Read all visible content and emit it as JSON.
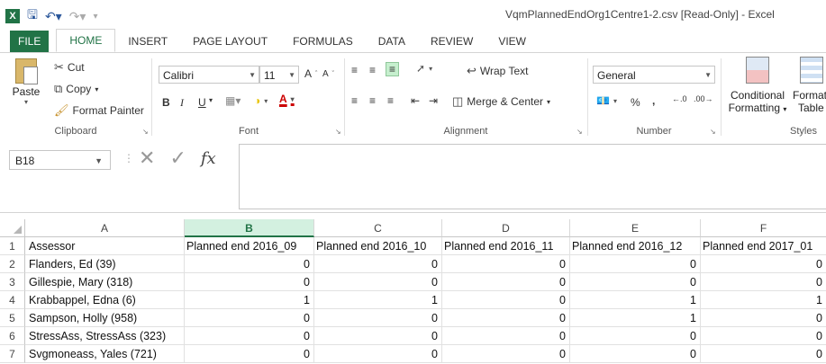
{
  "window": {
    "title": "VqmPlannedEndOrg1Centre1-2.csv  [Read-Only] - Excel",
    "app_icon": "X",
    "quick_access": [
      "save-icon",
      "undo-icon",
      "redo-icon",
      "customize-icon"
    ]
  },
  "ribbon_tabs": [
    {
      "label": "FILE"
    },
    {
      "label": "HOME"
    },
    {
      "label": "INSERT"
    },
    {
      "label": "PAGE LAYOUT"
    },
    {
      "label": "FORMULAS"
    },
    {
      "label": "DATA"
    },
    {
      "label": "REVIEW"
    },
    {
      "label": "VIEW"
    }
  ],
  "clipboard": {
    "paste": "Paste",
    "cut": "Cut",
    "copy": "Copy",
    "format_painter": "Format Painter",
    "label": "Clipboard"
  },
  "font": {
    "name": "Calibri",
    "size": "11",
    "bold": "B",
    "italic": "I",
    "underline": "U",
    "label": "Font"
  },
  "alignment": {
    "wrap_text": "Wrap Text",
    "merge_center": "Merge & Center",
    "label": "Alignment"
  },
  "number": {
    "format": "General",
    "percent": "%",
    "comma": ",",
    "label": "Number"
  },
  "styles": {
    "conditional_formatting_line1": "Conditional",
    "conditional_formatting_line2": "Formatting",
    "format_table_line1": "Format",
    "format_table_line2": "Table",
    "label": "Styles"
  },
  "formula_bar": {
    "name_box": "B18",
    "fx": "fx",
    "value": ""
  },
  "sheet": {
    "columns": [
      "A",
      "B",
      "C",
      "D",
      "E",
      "F"
    ],
    "selected_column": "B",
    "rows": [
      {
        "num": "1",
        "cells": [
          "Assessor",
          "Planned end 2016_09",
          "Planned end 2016_10",
          "Planned end 2016_11",
          "Planned end 2016_12",
          "Planned end 2017_01"
        ]
      },
      {
        "num": "2",
        "cells": [
          "Flanders, Ed  (39)",
          "0",
          "0",
          "0",
          "0",
          "0"
        ]
      },
      {
        "num": "3",
        "cells": [
          "Gillespie, Mary (318)",
          "0",
          "0",
          "0",
          "0",
          "0"
        ]
      },
      {
        "num": "4",
        "cells": [
          "Krabbappel, Edna (6)",
          "1",
          "1",
          "0",
          "1",
          "1"
        ]
      },
      {
        "num": "5",
        "cells": [
          "Sampson, Holly (958)",
          "0",
          "0",
          "0",
          "1",
          "0"
        ]
      },
      {
        "num": "6",
        "cells": [
          "StressAss, StressAss (323)",
          "0",
          "0",
          "0",
          "0",
          "0"
        ]
      },
      {
        "num": "7",
        "cells": [
          "Svgmoneass, Yales (721)",
          "0",
          "0",
          "0",
          "0",
          "0"
        ]
      }
    ]
  },
  "colors": {
    "accent": "#217346",
    "selected_header_bg": "#d3f0e0"
  }
}
